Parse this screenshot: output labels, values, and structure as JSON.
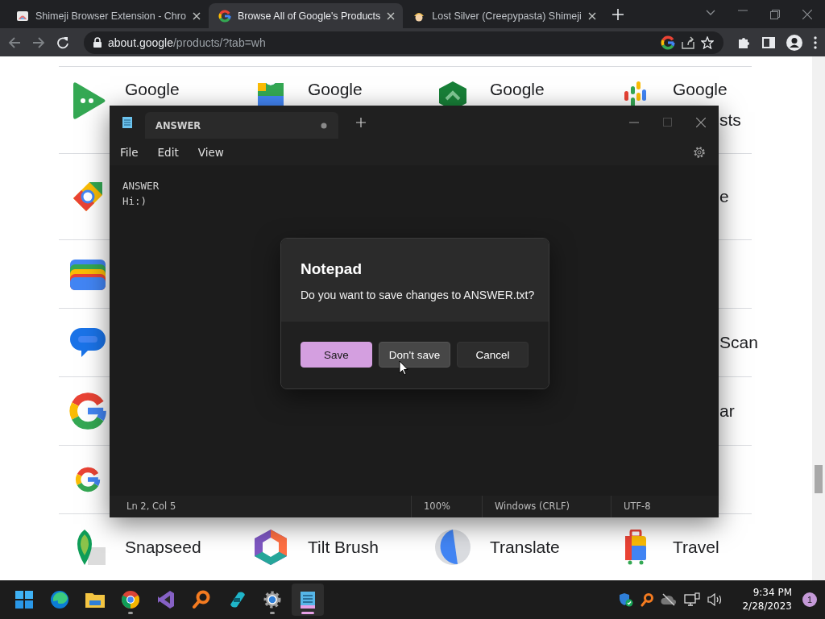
{
  "browser": {
    "tabs": [
      {
        "title": "Shimeji Browser Extension - Chro",
        "selected": false
      },
      {
        "title": "Browse All of Google's Products",
        "selected": true
      },
      {
        "title": "Lost Silver (Creepypasta) Shimeji",
        "selected": false
      }
    ],
    "address": {
      "host": "about.google",
      "path": "/products/?tab=wh"
    }
  },
  "products": {
    "rows": [
      {
        "labels": [
          "Google",
          "Google",
          "Google",
          "Google"
        ],
        "fragment": "sts"
      },
      {
        "fragment": "e"
      },
      {},
      {
        "fragment": "Scan"
      },
      {
        "fragment": "ar"
      },
      {},
      {
        "labels": [
          "Snapseed",
          "Tilt Brush",
          "Translate",
          "Travel"
        ]
      }
    ]
  },
  "notepad": {
    "tab": {
      "title": "ANSWER",
      "modified": true
    },
    "menu": [
      "File",
      "Edit",
      "View"
    ],
    "lines": [
      "ANSWER",
      "Hi:)"
    ],
    "status": [
      "Ln 2, Col 5",
      "100%",
      "Windows (CRLF)",
      "UTF-8"
    ],
    "dialog": {
      "title": "Notepad",
      "message": "Do you want to save changes to ANSWER.txt?",
      "buttons": [
        {
          "label": "Save",
          "primary": true,
          "hovered": false
        },
        {
          "label": "Don't save",
          "primary": false,
          "hovered": true
        },
        {
          "label": "Cancel",
          "primary": false,
          "hovered": false
        }
      ]
    }
  },
  "taskbar": {
    "apps": [
      {
        "running": false,
        "active": false
      },
      {
        "running": false,
        "active": false
      },
      {
        "running": true,
        "active": false
      },
      {
        "running": false,
        "active": false
      },
      {
        "running": false,
        "active": false
      },
      {
        "running": false,
        "active": false
      },
      {
        "running": true,
        "active": false
      },
      {
        "running": true,
        "active": true
      }
    ],
    "time": "9:34 PM",
    "date": "2/28/2023",
    "notifications": "1"
  }
}
